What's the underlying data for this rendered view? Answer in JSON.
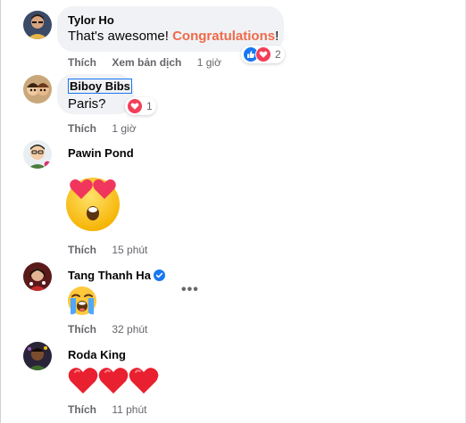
{
  "comments": [
    {
      "author": "Tylor Ho",
      "text_before": "That's awesome! ",
      "text_highlight": "Congratulations",
      "text_after": "!",
      "actions": {
        "like": "Thích",
        "translate": "Xem bản dịch",
        "time": "1 giờ"
      },
      "reaction_count": "2",
      "reaction_icons": [
        "like-icon",
        "love-icon"
      ]
    },
    {
      "author": "Biboy Bibs",
      "text": "Paris?",
      "actions": {
        "like": "Thích",
        "time": "1 giờ"
      },
      "reaction_count": "1",
      "reaction_icons": [
        "love-icon"
      ]
    },
    {
      "author": "Pawin Pond",
      "emoji": "heart-eyes-emoji",
      "actions": {
        "like": "Thích",
        "time": "15 phút"
      }
    },
    {
      "author": "Tang Thanh Ha",
      "verified": true,
      "emoji": "loudly-crying-emoji",
      "more": "•••",
      "actions": {
        "like": "Thích",
        "time": "32 phút"
      }
    },
    {
      "author": "Roda King",
      "emoji": "three-red-hearts",
      "actions": {
        "like": "Thích",
        "time": "11 phút"
      }
    }
  ],
  "colors": {
    "bubble": "#f0f2f5",
    "highlight": "#ef6a49",
    "secondary_text": "#65676b",
    "like_blue": "#1877f2",
    "love_red": "#f33e58"
  }
}
